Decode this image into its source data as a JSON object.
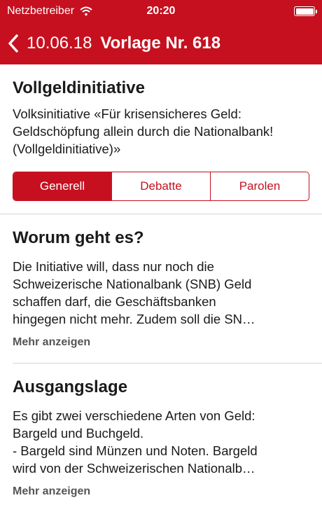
{
  "status_bar": {
    "carrier": "Netzbetreiber",
    "time": "20:20",
    "wifi_icon": "wifi-icon",
    "battery_level_percent": 100
  },
  "nav": {
    "back_label": "10.06.18",
    "title": "Vorlage Nr. 618",
    "back_icon": "chevron-left-icon"
  },
  "header": {
    "title": "Vollgeldinitiative",
    "description": "Volksinitiative «Für krisensicheres Geld: Geldschöpfung allein durch die Nationalbank! (Vollgeldinitiative)»"
  },
  "tabs": [
    {
      "label": "Generell",
      "active": true
    },
    {
      "label": "Debatte",
      "active": false
    },
    {
      "label": "Parolen",
      "active": false
    }
  ],
  "sections": [
    {
      "title": "Worum geht es?",
      "text_lines": [
        "Die Initiative will, dass nur noch die",
        "Schweizerische Nationalbank (SNB) Geld",
        "schaffen darf, die Geschäftsbanken",
        "hingegen nicht mehr. Zudem soll die SN…"
      ],
      "more_label": "Mehr anzeigen"
    },
    {
      "title": "Ausgangslage",
      "text_lines": [
        "Es gibt zwei verschiedene Arten von Geld:",
        "Bargeld und Buchgeld.",
        "- Bargeld sind Münzen und Noten. Bargeld",
        "wird von der Schweizerischen Nationalb…"
      ],
      "more_label": "Mehr anzeigen"
    }
  ],
  "colors": {
    "accent": "#c6101f",
    "text": "#1a1a1a",
    "muted": "#555555",
    "divider": "#d6d6d6"
  }
}
